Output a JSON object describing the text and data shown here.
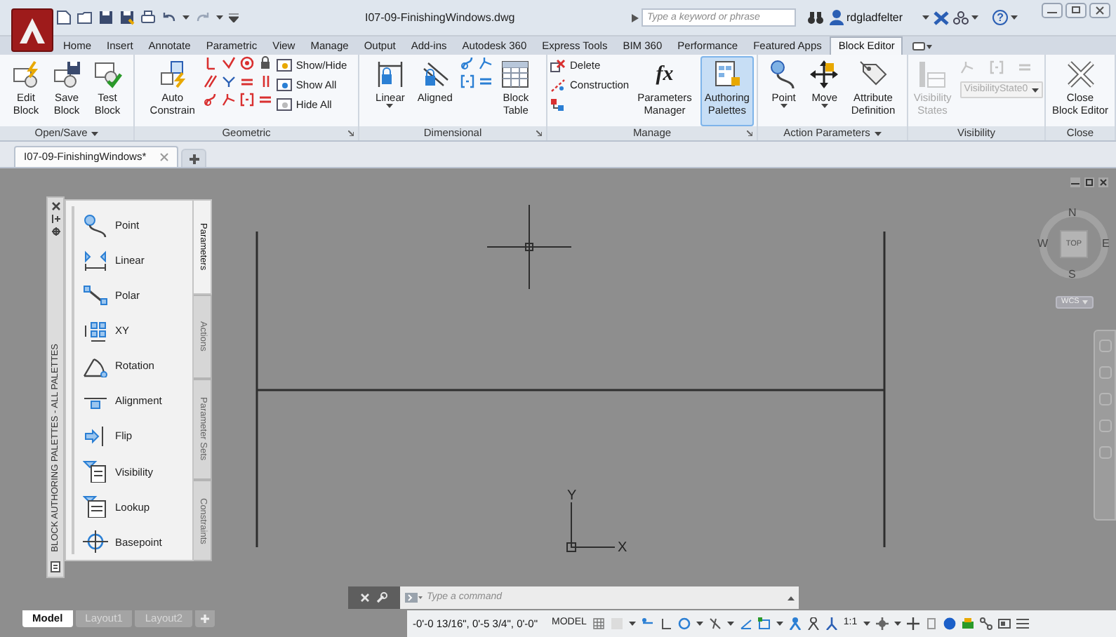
{
  "title_bar": {
    "document": "I07-09-FinishingWindows.dwg",
    "search": {
      "placeholder": "Type a keyword or phrase"
    },
    "user": "rdgladfelter",
    "help": "?"
  },
  "ribbon_tabs": [
    {
      "label": "Home",
      "selected": false
    },
    {
      "label": "Insert",
      "selected": false
    },
    {
      "label": "Annotate",
      "selected": false
    },
    {
      "label": "Parametric",
      "selected": false
    },
    {
      "label": "View",
      "selected": false
    },
    {
      "label": "Manage",
      "selected": false
    },
    {
      "label": "Output",
      "selected": false
    },
    {
      "label": "Add-ins",
      "selected": false
    },
    {
      "label": "Autodesk 360",
      "selected": false
    },
    {
      "label": "Express Tools",
      "selected": false
    },
    {
      "label": "BIM 360",
      "selected": false
    },
    {
      "label": "Performance",
      "selected": false
    },
    {
      "label": "Featured Apps",
      "selected": false
    },
    {
      "label": "Block Editor",
      "selected": true
    }
  ],
  "panels": [
    {
      "label": "Open/Save",
      "menu": true,
      "launcher": false,
      "tools": [
        {
          "kind": "large",
          "lines": [
            "Edit",
            "Block"
          ],
          "selected": false,
          "disabled": false,
          "menu": false
        },
        {
          "kind": "large",
          "lines": [
            "Save",
            "Block"
          ],
          "selected": false,
          "disabled": false,
          "menu": false
        },
        {
          "kind": "large",
          "lines": [
            "Test",
            "Block"
          ],
          "selected": false,
          "disabled": false,
          "menu": false
        }
      ]
    },
    {
      "label": "Geometric",
      "menu": false,
      "launcher": true,
      "tools": [
        {
          "kind": "large",
          "lines": [
            "Auto",
            "Constrain"
          ],
          "selected": false,
          "disabled": false,
          "menu": false
        },
        {
          "kind": "grid",
          "disabled": false
        },
        {
          "kind": "list",
          "items": [
            {
              "kind": "text",
              "label": "Show/Hide"
            },
            {
              "kind": "text",
              "label": "Show All"
            },
            {
              "kind": "text",
              "label": "Hide All"
            }
          ]
        }
      ]
    },
    {
      "label": "Dimensional",
      "menu": false,
      "launcher": true,
      "tools": [
        {
          "kind": "large",
          "lines": [
            "Linear"
          ],
          "selected": false,
          "disabled": false,
          "menu": true
        },
        {
          "kind": "large",
          "lines": [
            "Aligned"
          ],
          "selected": false,
          "disabled": false,
          "menu": false
        },
        {
          "kind": "grid",
          "disabled": false
        },
        {
          "kind": "large",
          "lines": [
            "Block",
            "Table"
          ],
          "selected": false,
          "disabled": false,
          "menu": false
        }
      ]
    },
    {
      "label": "Manage",
      "menu": false,
      "launcher": true,
      "tools": [
        {
          "kind": "list",
          "items": [
            {
              "kind": "text",
              "label": "Delete"
            },
            {
              "kind": "text",
              "label": "Construction"
            },
            {
              "kind": "icon"
            }
          ]
        },
        {
          "kind": "large",
          "lines": [
            "Parameters",
            "Manager"
          ],
          "icon_text": "fx",
          "selected": false,
          "disabled": false,
          "menu": false
        },
        {
          "kind": "large",
          "lines": [
            "Authoring",
            "Palettes"
          ],
          "selected": true,
          "disabled": false,
          "menu": false
        }
      ]
    },
    {
      "label": "Action Parameters",
      "menu": true,
      "launcher": false,
      "tools": [
        {
          "kind": "large",
          "lines": [
            "Point"
          ],
          "selected": false,
          "disabled": false,
          "menu": true
        },
        {
          "kind": "large",
          "lines": [
            "Move"
          ],
          "selected": false,
          "disabled": false,
          "menu": true
        },
        {
          "kind": "large",
          "lines": [
            "Attribute",
            "Definition"
          ],
          "selected": false,
          "disabled": false,
          "menu": false
        }
      ]
    },
    {
      "label": "Visibility",
      "menu": false,
      "launcher": false,
      "tools": [
        {
          "kind": "large",
          "lines": [
            "Visibility",
            "States"
          ],
          "selected": false,
          "disabled": true,
          "menu": false
        },
        {
          "kind": "stack",
          "items": [
            {
              "kind": "grid",
              "disabled": true
            },
            {
              "kind": "dropdown",
              "value": "VisibilityState0",
              "disabled": true
            }
          ]
        }
      ]
    },
    {
      "label": "Close",
      "menu": false,
      "launcher": false,
      "tools": [
        {
          "kind": "large",
          "lines": [
            "Close",
            "Block Editor"
          ],
          "selected": false,
          "disabled": false,
          "menu": false
        }
      ]
    }
  ],
  "document_tabs": [
    {
      "label": "I07-09-FinishingWindows*",
      "selected": true
    }
  ],
  "palette": {
    "title": "BLOCK AUTHORING PALETTES - ALL PALETTES",
    "items": [
      {
        "label": "Point"
      },
      {
        "label": "Linear"
      },
      {
        "label": "Polar"
      },
      {
        "label": "XY"
      },
      {
        "label": "Rotation"
      },
      {
        "label": "Alignment"
      },
      {
        "label": "Flip"
      },
      {
        "label": "Visibility"
      },
      {
        "label": "Lookup"
      },
      {
        "label": "Basepoint"
      }
    ],
    "tabs": [
      {
        "label": "Parameters",
        "selected": true
      },
      {
        "label": "Actions",
        "selected": false
      },
      {
        "label": "Parameter Sets",
        "selected": false
      },
      {
        "label": "Constraints",
        "selected": false
      }
    ]
  },
  "ucs": {
    "x": "X",
    "y": "Y"
  },
  "viewcube": {
    "face": "TOP",
    "north": "N",
    "south": "S",
    "east": "E",
    "west": "W",
    "coordinate_system": "WCS"
  },
  "command_line": {
    "placeholder": "Type a command"
  },
  "layout_tabs": [
    {
      "label": "Model",
      "selected": true
    },
    {
      "label": "Layout1",
      "selected": false
    },
    {
      "label": "Layout2",
      "selected": false
    }
  ],
  "status_bar": {
    "coordinates": "-0'-0 13/16\", 0'-5 3/4\", 0'-0\"",
    "space": "MODEL",
    "scale": "1:1"
  }
}
